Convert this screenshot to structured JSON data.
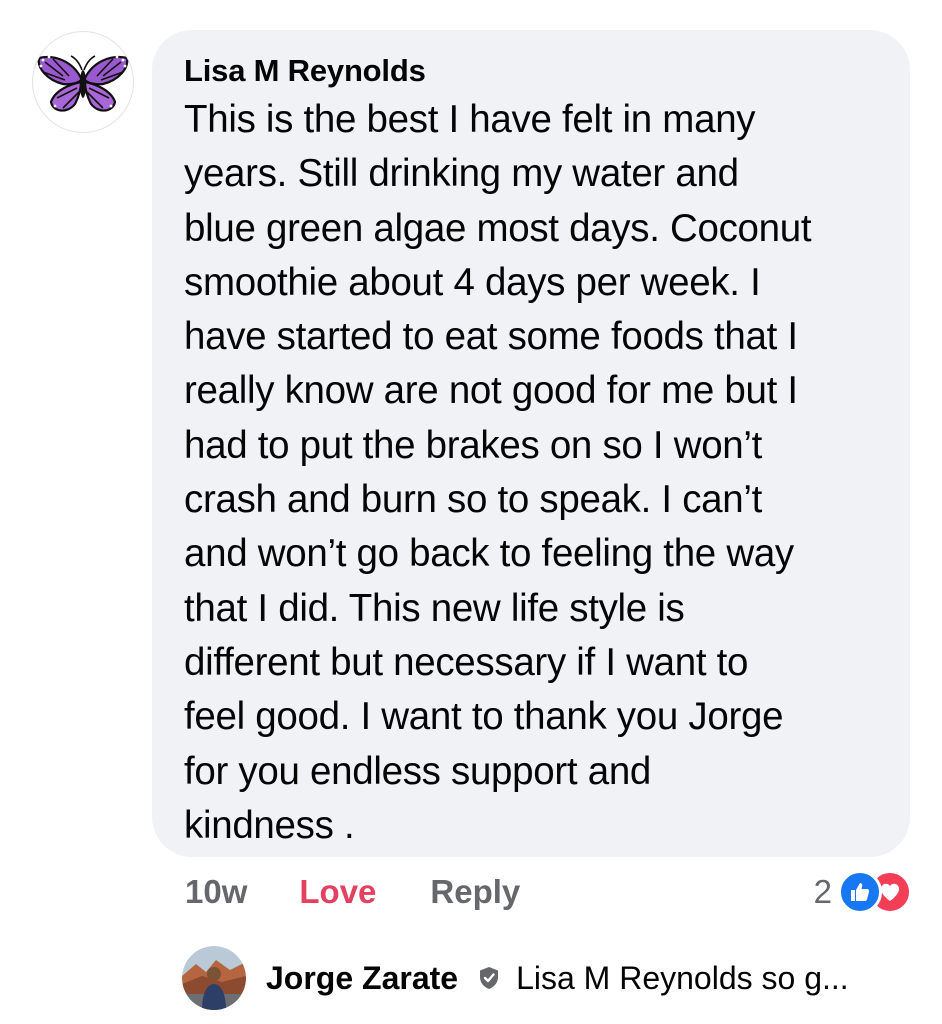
{
  "comment": {
    "author": "Lisa M Reynolds",
    "text": "This is the best I have felt in many\nyears. Still drinking my water and\nblue green algae most days. Coconut\nsmoothie about 4 days per week. I\nhave started to eat some foods that I\nreally know are not good for me but I\nhad to put the brakes on so I won’t\ncrash and burn so to speak. I can’t\nand won’t go back to feeling the way\nthat I did. This new life style is\ndifferent but necessary if I want to\nfeel good. I want to thank you  Jorge\nfor you endless support and\nkindness .",
    "avatar_icon": "purple-butterfly"
  },
  "actions": {
    "time": "10w",
    "love_label": "Love",
    "reply_label": "Reply"
  },
  "reactions": {
    "count": "2",
    "icons": [
      "like-icon",
      "love-icon"
    ],
    "like_color": "#1877f2",
    "love_color": "#f33e58"
  },
  "reply": {
    "author": "Jorge Zarate",
    "badge_icon": "shield-check-icon",
    "preview": "Lisa M Reynolds so g..."
  },
  "colors": {
    "bubble_bg": "#f0f2f5",
    "love_text": "#e4405f",
    "secondary_text": "#65676b"
  }
}
